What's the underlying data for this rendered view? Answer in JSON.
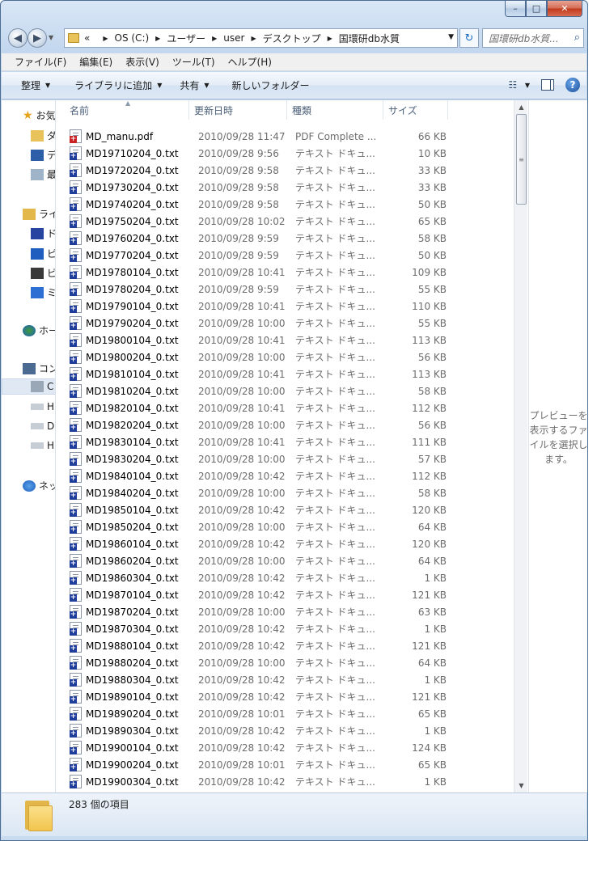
{
  "window": {
    "min_label": "–",
    "max_label": "□",
    "close_label": "✕"
  },
  "address": {
    "overflow": "«",
    "crumbs": [
      "OS (C:)",
      "ユーザー",
      "user",
      "デスクトップ",
      "国環研db水質"
    ]
  },
  "search": {
    "placeholder": "国環研db水質..."
  },
  "menu": [
    "ファイル(F)",
    "編集(E)",
    "表示(V)",
    "ツール(T)",
    "ヘルプ(H)"
  ],
  "toolbar": {
    "organize": "整理",
    "add_library": "ライブラリに追加",
    "share": "共有",
    "new_folder": "新しいフォルダー"
  },
  "nav": {
    "favorites": "お気",
    "fav_items": [
      "ダ",
      "デ",
      "最"
    ],
    "libraries": "ライ",
    "lib_items": [
      "ド",
      "ピ",
      "ビ",
      "ミ"
    ],
    "homegroup": "ホー",
    "computer": "コン",
    "computer_items": [
      "C",
      "H",
      "D",
      "H"
    ],
    "network": "ネッ"
  },
  "columns": {
    "name": "名前",
    "date": "更新日時",
    "type": "種類",
    "size": "サイズ"
  },
  "files": [
    {
      "name": "MD_manu.pdf",
      "date": "2010/09/28 11:47",
      "type": "PDF Complete ...",
      "size": "66 KB",
      "icon": "pdf"
    },
    {
      "name": "MD19710204_0.txt",
      "date": "2010/09/28 9:56",
      "type": "テキスト ドキュ...",
      "size": "10 KB",
      "icon": "txt"
    },
    {
      "name": "MD19720204_0.txt",
      "date": "2010/09/28 9:58",
      "type": "テキスト ドキュ...",
      "size": "33 KB",
      "icon": "txt"
    },
    {
      "name": "MD19730204_0.txt",
      "date": "2010/09/28 9:58",
      "type": "テキスト ドキュ...",
      "size": "33 KB",
      "icon": "txt"
    },
    {
      "name": "MD19740204_0.txt",
      "date": "2010/09/28 9:58",
      "type": "テキスト ドキュ...",
      "size": "50 KB",
      "icon": "txt"
    },
    {
      "name": "MD19750204_0.txt",
      "date": "2010/09/28 10:02",
      "type": "テキスト ドキュ...",
      "size": "65 KB",
      "icon": "txt"
    },
    {
      "name": "MD19760204_0.txt",
      "date": "2010/09/28 9:59",
      "type": "テキスト ドキュ...",
      "size": "58 KB",
      "icon": "txt"
    },
    {
      "name": "MD19770204_0.txt",
      "date": "2010/09/28 9:59",
      "type": "テキスト ドキュ...",
      "size": "50 KB",
      "icon": "txt"
    },
    {
      "name": "MD19780104_0.txt",
      "date": "2010/09/28 10:41",
      "type": "テキスト ドキュ...",
      "size": "109 KB",
      "icon": "txt"
    },
    {
      "name": "MD19780204_0.txt",
      "date": "2010/09/28 9:59",
      "type": "テキスト ドキュ...",
      "size": "55 KB",
      "icon": "txt"
    },
    {
      "name": "MD19790104_0.txt",
      "date": "2010/09/28 10:41",
      "type": "テキスト ドキュ...",
      "size": "110 KB",
      "icon": "txt"
    },
    {
      "name": "MD19790204_0.txt",
      "date": "2010/09/28 10:00",
      "type": "テキスト ドキュ...",
      "size": "55 KB",
      "icon": "txt"
    },
    {
      "name": "MD19800104_0.txt",
      "date": "2010/09/28 10:41",
      "type": "テキスト ドキュ...",
      "size": "113 KB",
      "icon": "txt"
    },
    {
      "name": "MD19800204_0.txt",
      "date": "2010/09/28 10:00",
      "type": "テキスト ドキュ...",
      "size": "56 KB",
      "icon": "txt"
    },
    {
      "name": "MD19810104_0.txt",
      "date": "2010/09/28 10:41",
      "type": "テキスト ドキュ...",
      "size": "113 KB",
      "icon": "txt"
    },
    {
      "name": "MD19810204_0.txt",
      "date": "2010/09/28 10:00",
      "type": "テキスト ドキュ...",
      "size": "58 KB",
      "icon": "txt"
    },
    {
      "name": "MD19820104_0.txt",
      "date": "2010/09/28 10:41",
      "type": "テキスト ドキュ...",
      "size": "112 KB",
      "icon": "txt"
    },
    {
      "name": "MD19820204_0.txt",
      "date": "2010/09/28 10:00",
      "type": "テキスト ドキュ...",
      "size": "56 KB",
      "icon": "txt"
    },
    {
      "name": "MD19830104_0.txt",
      "date": "2010/09/28 10:41",
      "type": "テキスト ドキュ...",
      "size": "111 KB",
      "icon": "txt"
    },
    {
      "name": "MD19830204_0.txt",
      "date": "2010/09/28 10:00",
      "type": "テキスト ドキュ...",
      "size": "57 KB",
      "icon": "txt"
    },
    {
      "name": "MD19840104_0.txt",
      "date": "2010/09/28 10:42",
      "type": "テキスト ドキュ...",
      "size": "112 KB",
      "icon": "txt"
    },
    {
      "name": "MD19840204_0.txt",
      "date": "2010/09/28 10:00",
      "type": "テキスト ドキュ...",
      "size": "58 KB",
      "icon": "txt"
    },
    {
      "name": "MD19850104_0.txt",
      "date": "2010/09/28 10:42",
      "type": "テキスト ドキュ...",
      "size": "120 KB",
      "icon": "txt"
    },
    {
      "name": "MD19850204_0.txt",
      "date": "2010/09/28 10:00",
      "type": "テキスト ドキュ...",
      "size": "64 KB",
      "icon": "txt"
    },
    {
      "name": "MD19860104_0.txt",
      "date": "2010/09/28 10:42",
      "type": "テキスト ドキュ...",
      "size": "120 KB",
      "icon": "txt"
    },
    {
      "name": "MD19860204_0.txt",
      "date": "2010/09/28 10:00",
      "type": "テキスト ドキュ...",
      "size": "64 KB",
      "icon": "txt"
    },
    {
      "name": "MD19860304_0.txt",
      "date": "2010/09/28 10:42",
      "type": "テキスト ドキュ...",
      "size": "1 KB",
      "icon": "txt"
    },
    {
      "name": "MD19870104_0.txt",
      "date": "2010/09/28 10:42",
      "type": "テキスト ドキュ...",
      "size": "121 KB",
      "icon": "txt"
    },
    {
      "name": "MD19870204_0.txt",
      "date": "2010/09/28 10:00",
      "type": "テキスト ドキュ...",
      "size": "63 KB",
      "icon": "txt"
    },
    {
      "name": "MD19870304_0.txt",
      "date": "2010/09/28 10:42",
      "type": "テキスト ドキュ...",
      "size": "1 KB",
      "icon": "txt"
    },
    {
      "name": "MD19880104_0.txt",
      "date": "2010/09/28 10:42",
      "type": "テキスト ドキュ...",
      "size": "121 KB",
      "icon": "txt"
    },
    {
      "name": "MD19880204_0.txt",
      "date": "2010/09/28 10:00",
      "type": "テキスト ドキュ...",
      "size": "64 KB",
      "icon": "txt"
    },
    {
      "name": "MD19880304_0.txt",
      "date": "2010/09/28 10:42",
      "type": "テキスト ドキュ...",
      "size": "1 KB",
      "icon": "txt"
    },
    {
      "name": "MD19890104_0.txt",
      "date": "2010/09/28 10:42",
      "type": "テキスト ドキュ...",
      "size": "121 KB",
      "icon": "txt"
    },
    {
      "name": "MD19890204_0.txt",
      "date": "2010/09/28 10:01",
      "type": "テキスト ドキュ...",
      "size": "65 KB",
      "icon": "txt"
    },
    {
      "name": "MD19890304_0.txt",
      "date": "2010/09/28 10:42",
      "type": "テキスト ドキュ...",
      "size": "1 KB",
      "icon": "txt"
    },
    {
      "name": "MD19900104_0.txt",
      "date": "2010/09/28 10:42",
      "type": "テキスト ドキュ...",
      "size": "124 KB",
      "icon": "txt"
    },
    {
      "name": "MD19900204_0.txt",
      "date": "2010/09/28 10:01",
      "type": "テキスト ドキュ...",
      "size": "65 KB",
      "icon": "txt"
    },
    {
      "name": "MD19900304_0.txt",
      "date": "2010/09/28 10:42",
      "type": "テキスト ドキュ...",
      "size": "1 KB",
      "icon": "txt"
    }
  ],
  "preview": {
    "message": "プレビューを表示するファイルを選択します。"
  },
  "status": {
    "count": "283 個の項目"
  },
  "colors": {
    "window_frame": "#c3d7ee",
    "selection": "#dfe8f3",
    "txt_icon_badge": "#1f3e9c",
    "pdf_icon_badge": "#c92222"
  }
}
